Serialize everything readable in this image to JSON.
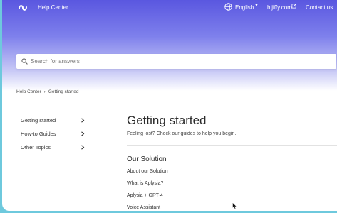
{
  "header": {
    "nav_title": "Help Center",
    "language": "English",
    "site_link": "hijiffy.com",
    "contact": "Contact us"
  },
  "search": {
    "placeholder": "Search for answers"
  },
  "breadcrumb": {
    "home": "Help Center",
    "current": "Getting started"
  },
  "sidebar": {
    "items": [
      {
        "label": "Getting started"
      },
      {
        "label": "How-to Guides"
      },
      {
        "label": "Other Topics"
      }
    ]
  },
  "main": {
    "title": "Getting started",
    "subtitle": "Feeling lost? Check our guides to help you begin.",
    "section_title": "Our Solution",
    "links": [
      {
        "label": "About our Solution"
      },
      {
        "label": "What is Aplysia?"
      },
      {
        "label": "Aplysia + GPT-4"
      },
      {
        "label": "Voice Assistant"
      }
    ]
  },
  "colors": {
    "hero_top": "#5a57e0",
    "page_edge": "#6ec9dd"
  }
}
